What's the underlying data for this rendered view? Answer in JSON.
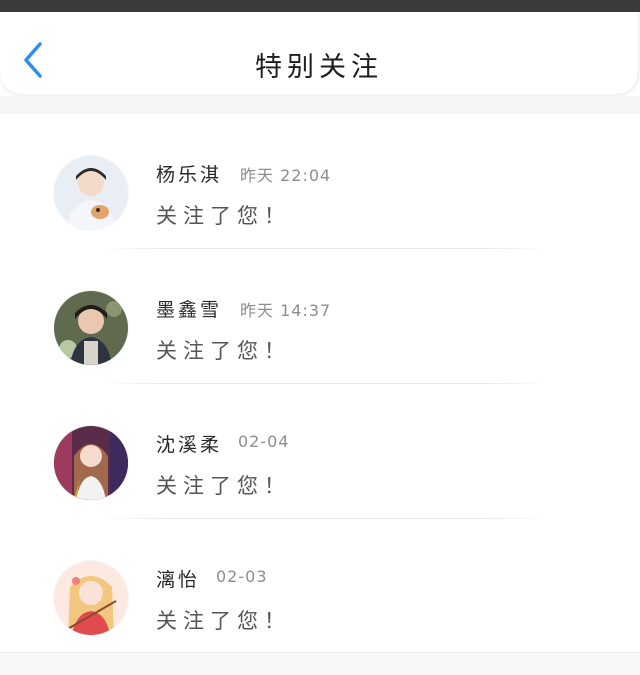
{
  "header": {
    "title": "特别关注"
  },
  "icons": {
    "back": "chevron-left-icon"
  },
  "colors": {
    "accent": "#2f8ee6"
  },
  "items": [
    {
      "name": "杨乐淇",
      "time": "昨天 22:04",
      "message": "关注了您！"
    },
    {
      "name": "墨鑫雪",
      "time": "昨天 14:37",
      "message": "关注了您！"
    },
    {
      "name": "沈溪柔",
      "time": "02-04",
      "message": "关注了您！"
    },
    {
      "name": "漓怡",
      "time": "02-03",
      "message": "关注了您！"
    }
  ]
}
